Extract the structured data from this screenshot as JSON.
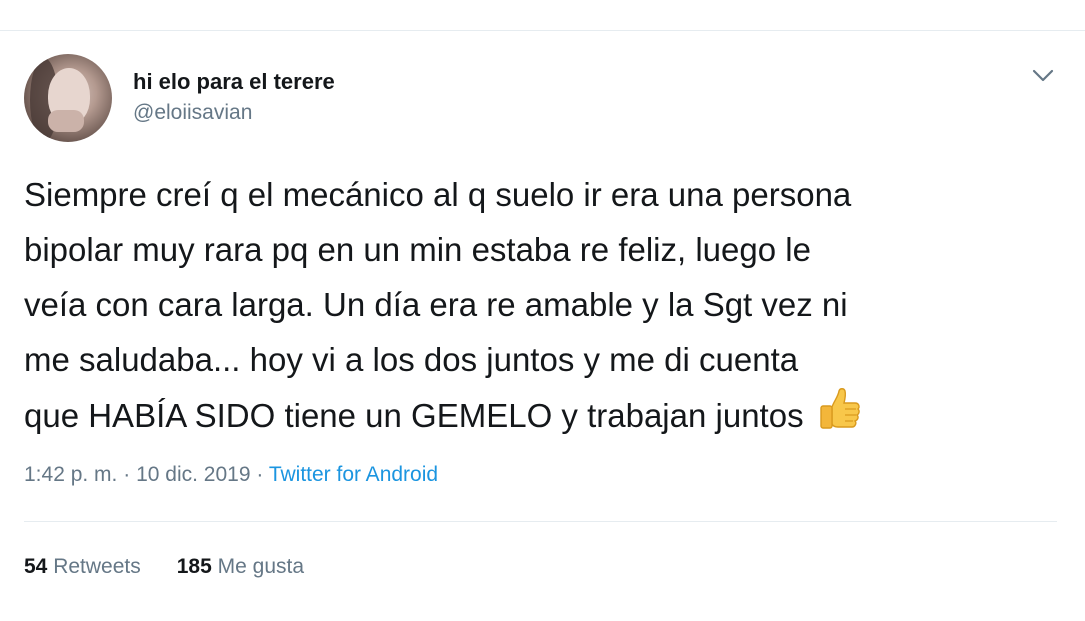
{
  "tweet": {
    "user_name": "hi elo para el terere",
    "handle": "@eloiisavian",
    "text_lines": [
      "Siempre creí q el mecánico al q suelo ir era una persona",
      "bipolar muy rara pq en un min estaba re feliz, luego le",
      "veía con cara larga. Un día era re amable y la Sgt vez ni",
      "me saludaba... hoy vi a los dos juntos y me di cuenta",
      "que HABÍA SIDO tiene un GEMELO y trabajan juntos"
    ],
    "emoji": "thumbs-up",
    "time": "1:42 p. m.",
    "separator": "·",
    "date": "10 dic. 2019",
    "source": "Twitter for Android",
    "retweets_count": "54",
    "retweets_label": "Retweets",
    "likes_count": "185",
    "likes_label": "Me gusta"
  },
  "icons": {
    "more": "chevron-down-icon",
    "emoji": "thumbs-up-icon"
  },
  "colors": {
    "text": "#14171a",
    "secondary": "#657786",
    "link": "#1b95e0",
    "divider": "#e6ecf0"
  }
}
